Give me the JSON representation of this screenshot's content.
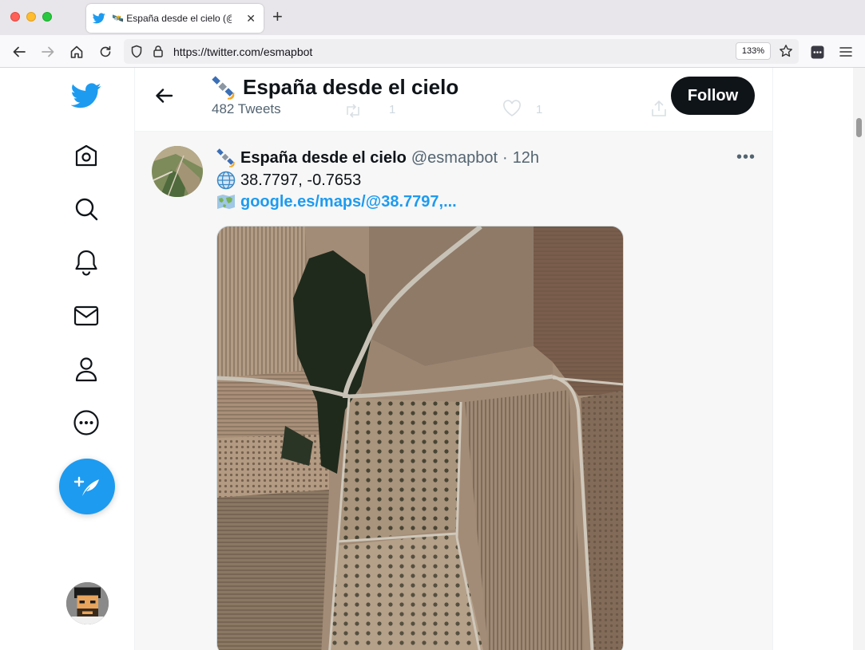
{
  "browser": {
    "tab_title": "🛰️ España desde el cielo (@esmapbot",
    "tab_close": "✕",
    "new_tab": "+",
    "url": "https://twitter.com/esmapbot",
    "zoom": "133%"
  },
  "profile_header": {
    "name": "España desde el cielo",
    "tweet_count": "482 Tweets",
    "follow_label": "Follow",
    "ghost_reply_count": "1",
    "ghost_like_count": "1"
  },
  "tweet": {
    "display_name": "España desde el cielo",
    "handle": "@esmapbot",
    "separator": "·",
    "time": "12h",
    "more": "•••",
    "coordinates": "38.7797, -0.7653",
    "link": "google.es/maps/@38.7797,..."
  },
  "nav": {
    "items": [
      "twitter-logo",
      "home",
      "explore",
      "notifications",
      "messages",
      "profile",
      "more"
    ]
  },
  "colors": {
    "twitter_blue": "#1d9bf0",
    "text": "#0f1419",
    "muted": "#536471"
  }
}
